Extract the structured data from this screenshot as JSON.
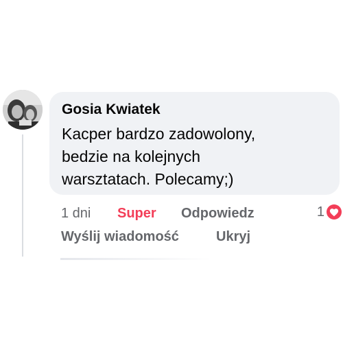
{
  "comment": {
    "author": "Gosia Kwiatek",
    "text": "Kacper bardzo zadowolony, bedzie na kolejnych warsztatach. Polecamy;)"
  },
  "actions": {
    "time": "1 dni",
    "reaction": "Super",
    "reply": "Odpowiedz",
    "message": "Wyślij wiadomość",
    "hide": "Ukryj"
  },
  "reactions": {
    "count": "1",
    "icon": "heart-icon"
  },
  "colors": {
    "bubble": "#f0f2f5",
    "text": "#050505",
    "secondary": "#65676b",
    "super_reaction": "#f33e58"
  }
}
